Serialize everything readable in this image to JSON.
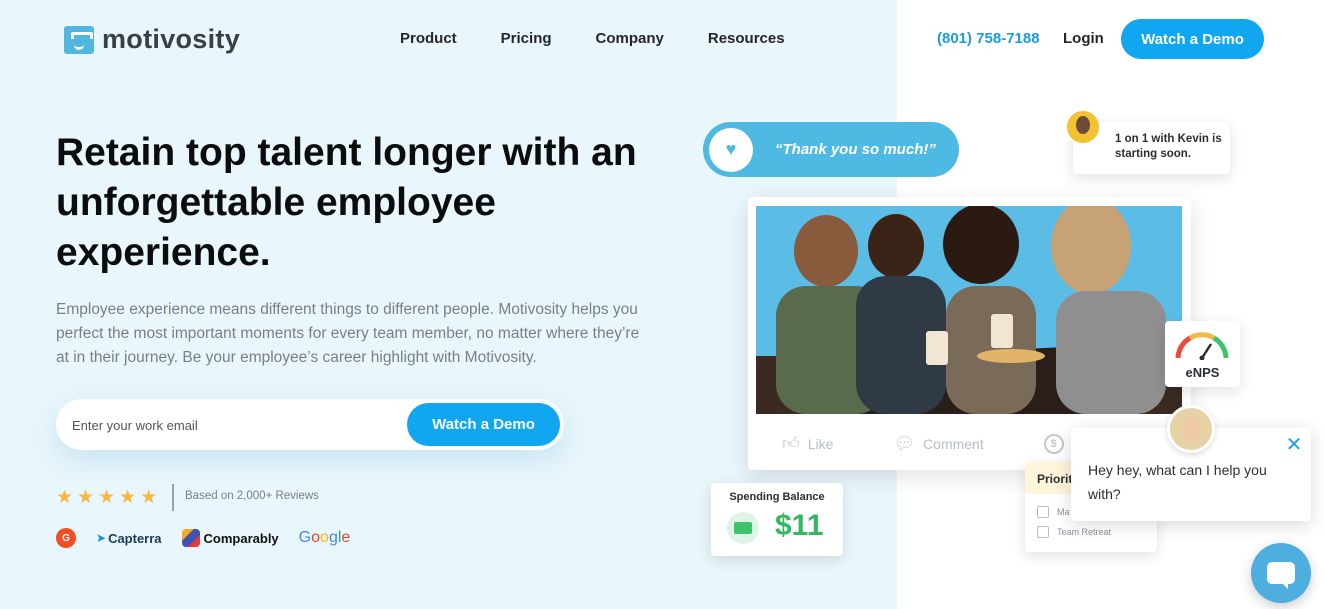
{
  "nav": {
    "logo_text": "motivosity",
    "links": [
      "Product",
      "Pricing",
      "Company",
      "Resources"
    ],
    "phone": "(801) 758-7188",
    "login": "Login",
    "cta": "Watch a Demo"
  },
  "hero": {
    "headline": "Retain top talent longer with an unforgettable employee experience.",
    "subtext": "Employee experience means different things to different people. Motivosity helps you perfect the most important moments for every team member, no matter where they’re at in their journey. Be your employee’s career highlight with Motivosity.",
    "email_placeholder": "Enter your work email",
    "cta": "Watch a Demo",
    "rating_stars": 5,
    "reviews_text": "Based on 2,000+ Reviews",
    "badges": {
      "g2": "G",
      "capterra": "Capterra",
      "comparably": "Comparably",
      "google": [
        "G",
        "o",
        "o",
        "g",
        "l",
        "e"
      ]
    }
  },
  "visual": {
    "thank_you": "“Thank you so much!”",
    "meeting": "1 on 1 with Kevin is starting soon.",
    "actions": {
      "like": "Like",
      "comment": "Comment"
    },
    "enps": "eNPS",
    "spending_balance_label": "Spending Balance",
    "spending_balance_amount": "$11",
    "priority_title": "Priorit",
    "priority_items": [
      "Ma",
      "Team Retreat"
    ]
  },
  "chat": {
    "message": "Hey hey, what can I help you with?"
  },
  "colors": {
    "accent": "#10a6f0",
    "hero_bg": "#e9f6fb",
    "pill": "#4eb9e3",
    "money": "#32b85f"
  }
}
